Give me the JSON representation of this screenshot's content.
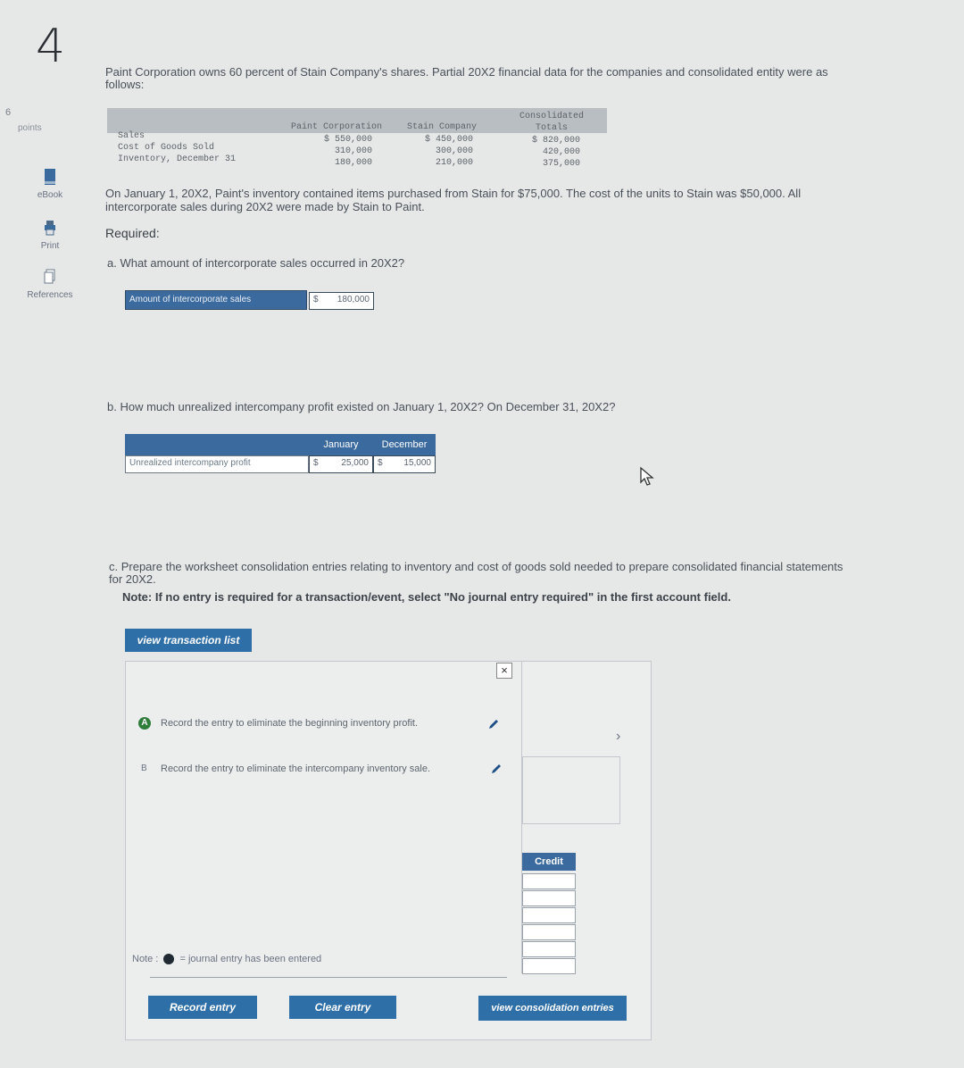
{
  "question_number": "4",
  "points": {
    "value": "6",
    "label": "points"
  },
  "sidebar": [
    {
      "label": "eBook",
      "icon": "book-icon"
    },
    {
      "label": "Print",
      "icon": "print-icon"
    },
    {
      "label": "References",
      "icon": "references-icon"
    }
  ],
  "intro": "Paint Corporation owns 60 percent of Stain Company's shares. Partial 20X2 financial data for the companies and consolidated entity were as follows:",
  "financial_table": {
    "headers": [
      "Paint Corporation",
      "Stain Company",
      "Consolidated Totals"
    ],
    "rows": [
      {
        "label": "Sales",
        "values": [
          "$ 550,000",
          "$ 450,000",
          "$ 820,000"
        ]
      },
      {
        "label": "Cost of Goods Sold",
        "values": [
          "310,000",
          "300,000",
          "420,000"
        ]
      },
      {
        "label": "Inventory, December 31",
        "values": [
          "180,000",
          "210,000",
          "375,000"
        ]
      }
    ]
  },
  "paragraph": "On January 1, 20X2, Paint's inventory contained items purchased from Stain for $75,000. The cost of the units to Stain was $50,000. All intercorporate sales during 20X2 were made by Stain to Paint.",
  "required_label": "Required:",
  "part_a": {
    "question": "a. What amount of intercorporate sales occurred in 20X2?",
    "row_label": "Amount of intercorporate sales",
    "currency": "$",
    "value": "180,000"
  },
  "part_b": {
    "question": "b. How much unrealized intercompany profit existed on January 1, 20X2? On December 31, 20X2?",
    "col_january": "January",
    "col_december": "December",
    "row_label": "Unrealized intercompany profit",
    "currency_jan": "$",
    "value_jan": "25,000",
    "currency_dec": "$",
    "value_dec": "15,000"
  },
  "part_c": {
    "question": "c. Prepare the worksheet consolidation entries relating to inventory and cost of goods sold needed to prepare consolidated financial statements for 20X2.",
    "note": "Note: If no entry is required for a transaction/event, select \"No journal entry required\" in the first account field."
  },
  "view_transaction_list_label": "view transaction list",
  "entries": [
    {
      "badge": "A",
      "text": "Record the entry to eliminate the beginning inventory profit."
    },
    {
      "badge": "B",
      "text": "Record the entry to eliminate the intercompany inventory sale."
    }
  ],
  "credit_header": "Credit",
  "legend_note": {
    "prefix": "Note :",
    "text": "= journal entry has been entered"
  },
  "buttons": {
    "record_entry": "Record entry",
    "clear_entry": "Clear entry",
    "view_consolidation_entries": "view consolidation entries"
  },
  "close_symbol": "×",
  "next_symbol": "›",
  "colors": {
    "accent": "#2f6fa8",
    "header_blue": "#3b6a9e",
    "badge_green": "#2f7d3b"
  }
}
